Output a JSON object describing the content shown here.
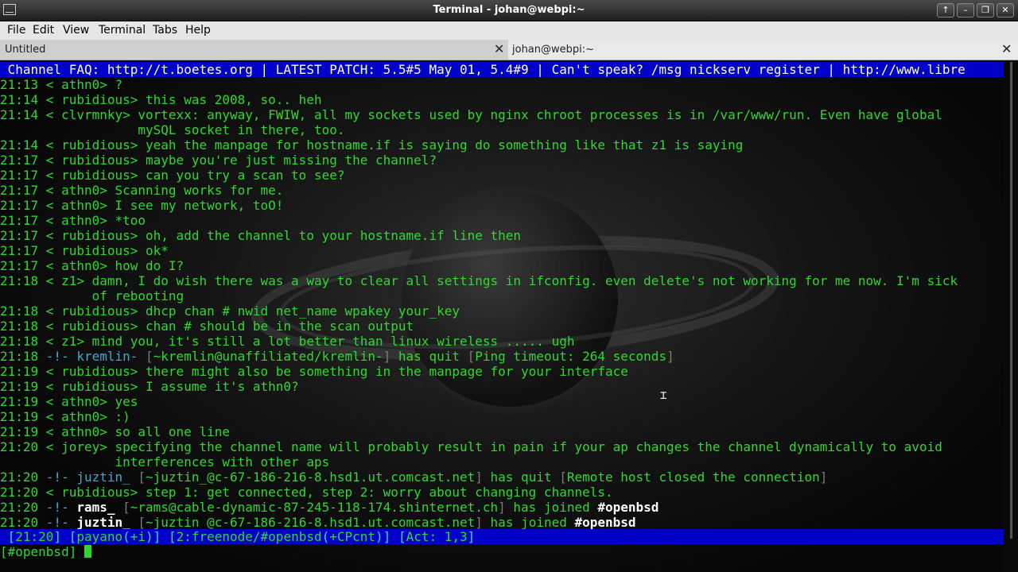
{
  "window": {
    "title": "Terminal - johan@webpi:~"
  },
  "window_buttons": [
    "↑",
    "–",
    "❐",
    "✕"
  ],
  "menu": [
    "File",
    "Edit",
    "View",
    "Terminal",
    "Tabs",
    "Help"
  ],
  "tabs": [
    {
      "label": "Untitled",
      "close": "✕"
    },
    {
      "label": "johan@webpi:~",
      "close": "✕"
    }
  ],
  "topic": " Channel FAQ: http://t.boetes.org | LATEST PATCH: 5.5#5 May 01, 5.4#9 | Can't speak? /msg nickserv register | http://www.libre",
  "lines": [
    [
      [
        "21:13 < athn0> ?",
        "c"
      ]
    ],
    [
      [
        "21:14 < rubidious> this was 2008, so.. heh",
        "c"
      ]
    ],
    [
      [
        "21:14 < clvrmnky> vortexx: anyway, FWIW, all my sockets used by nginx chroot processes is in /var/www/run. Even have global",
        "c"
      ]
    ],
    [
      [
        "                  mySQL socket in there, too.",
        "c"
      ]
    ],
    [
      [
        "21:14 < rubidious> yeah the manpage for hostname.if is saying do something like that z1 is saying",
        "c"
      ]
    ],
    [
      [
        "21:17 < rubidious> maybe you're just missing the channel?",
        "c"
      ]
    ],
    [
      [
        "21:17 < rubidious> can you try a scan to see?",
        "c"
      ]
    ],
    [
      [
        "21:17 < athn0> Scanning works for me.",
        "c"
      ]
    ],
    [
      [
        "21:17 < athn0> I see my network, toO!",
        "c"
      ]
    ],
    [
      [
        "21:17 < athn0> *too",
        "c"
      ]
    ],
    [
      [
        "21:17 < rubidious> oh, add the channel to your hostname.if line then",
        "c"
      ]
    ],
    [
      [
        "21:17 < rubidious> ok*",
        "c"
      ]
    ],
    [
      [
        "21:17 < athn0> how do I?",
        "c"
      ]
    ],
    [
      [
        "21:18 < z1> damn, I do wish there was a way to clear all settings in ifconfig. even delete's not working for me now. I'm sick",
        "c"
      ]
    ],
    [
      [
        "            of rebooting",
        "c"
      ]
    ],
    [
      [
        "21:18 < rubidious> dhcp chan # nwid net_name wpakey your_key",
        "c"
      ]
    ],
    [
      [
        "21:18 < rubidious> chan # should be in the scan output",
        "c"
      ]
    ],
    [
      [
        "21:18 < z1> mind you, it's still a lot better than linux wireless ..... ugh",
        "c"
      ]
    ],
    [
      [
        "21:18 ",
        "c"
      ],
      [
        "-!- ",
        "cy"
      ],
      [
        "kremlin-",
        "cy"
      ],
      [
        " [",
        "dg"
      ],
      [
        "~kremlin@unaffiliated/kremlin-",
        "c"
      ],
      [
        "]",
        "dg"
      ],
      [
        " has quit ",
        "c"
      ],
      [
        "[",
        "dg"
      ],
      [
        "Ping timeout: 264 seconds",
        "c"
      ],
      [
        "]",
        "dg"
      ]
    ],
    [
      [
        "21:19 < rubidious> there might also be something in the manpage for your interface",
        "c"
      ]
    ],
    [
      [
        "21:19 < rubidious> I assume it's athn0?",
        "c"
      ]
    ],
    [
      [
        "21:19 < athn0> yes",
        "c"
      ]
    ],
    [
      [
        "21:19 < athn0> :)",
        "c"
      ]
    ],
    [
      [
        "21:19 < athn0> so all one line",
        "c"
      ]
    ],
    [
      [
        "21:20 < jorey> specifying the channel name will probably result in pain if your ap changes the channel dynamically to avoid",
        "c"
      ]
    ],
    [
      [
        "               interferences with other aps",
        "c"
      ]
    ],
    [
      [
        "21:20 ",
        "c"
      ],
      [
        "-!- ",
        "cy"
      ],
      [
        "juztin_",
        "cy"
      ],
      [
        " [",
        "dg"
      ],
      [
        "~juztin_@c-67-186-216-8.hsd1.ut.comcast.net",
        "c"
      ],
      [
        "]",
        "dg"
      ],
      [
        " has quit ",
        "c"
      ],
      [
        "[",
        "dg"
      ],
      [
        "Remote host closed the connection",
        "c"
      ],
      [
        "]",
        "dg"
      ]
    ],
    [
      [
        "21:20 < rubidious> step 1: get connected, step 2: worry about changing channels.",
        "c"
      ]
    ],
    [
      [
        "21:20 ",
        "c"
      ],
      [
        "-!- ",
        "cy"
      ],
      [
        "rams_",
        "wb"
      ],
      [
        " [",
        "dg"
      ],
      [
        "~rams@cable-dynamic-87-245-118-174.shinternet.ch",
        "c"
      ],
      [
        "]",
        "dg"
      ],
      [
        " has joined ",
        "c"
      ],
      [
        "#openbsd",
        "wb"
      ]
    ],
    [
      [
        "21:20 ",
        "c"
      ],
      [
        "-!- ",
        "cy"
      ],
      [
        "juztin_",
        "wb"
      ],
      [
        " [",
        "dg"
      ],
      [
        "~juztin_@c-67-186-216-8.hsd1.ut.comcast.net",
        "c"
      ],
      [
        "]",
        "dg"
      ],
      [
        " has joined ",
        "c"
      ],
      [
        "#openbsd",
        "wb"
      ]
    ]
  ],
  "status": {
    "time": "21:20",
    "nick": "payano",
    "mode": "+i",
    "window": "2:freenode/#openbsd",
    "chanmode": "+CPcnt",
    "act_label": "Act: ",
    "act": "1,3"
  },
  "prompt": "[#openbsd] "
}
